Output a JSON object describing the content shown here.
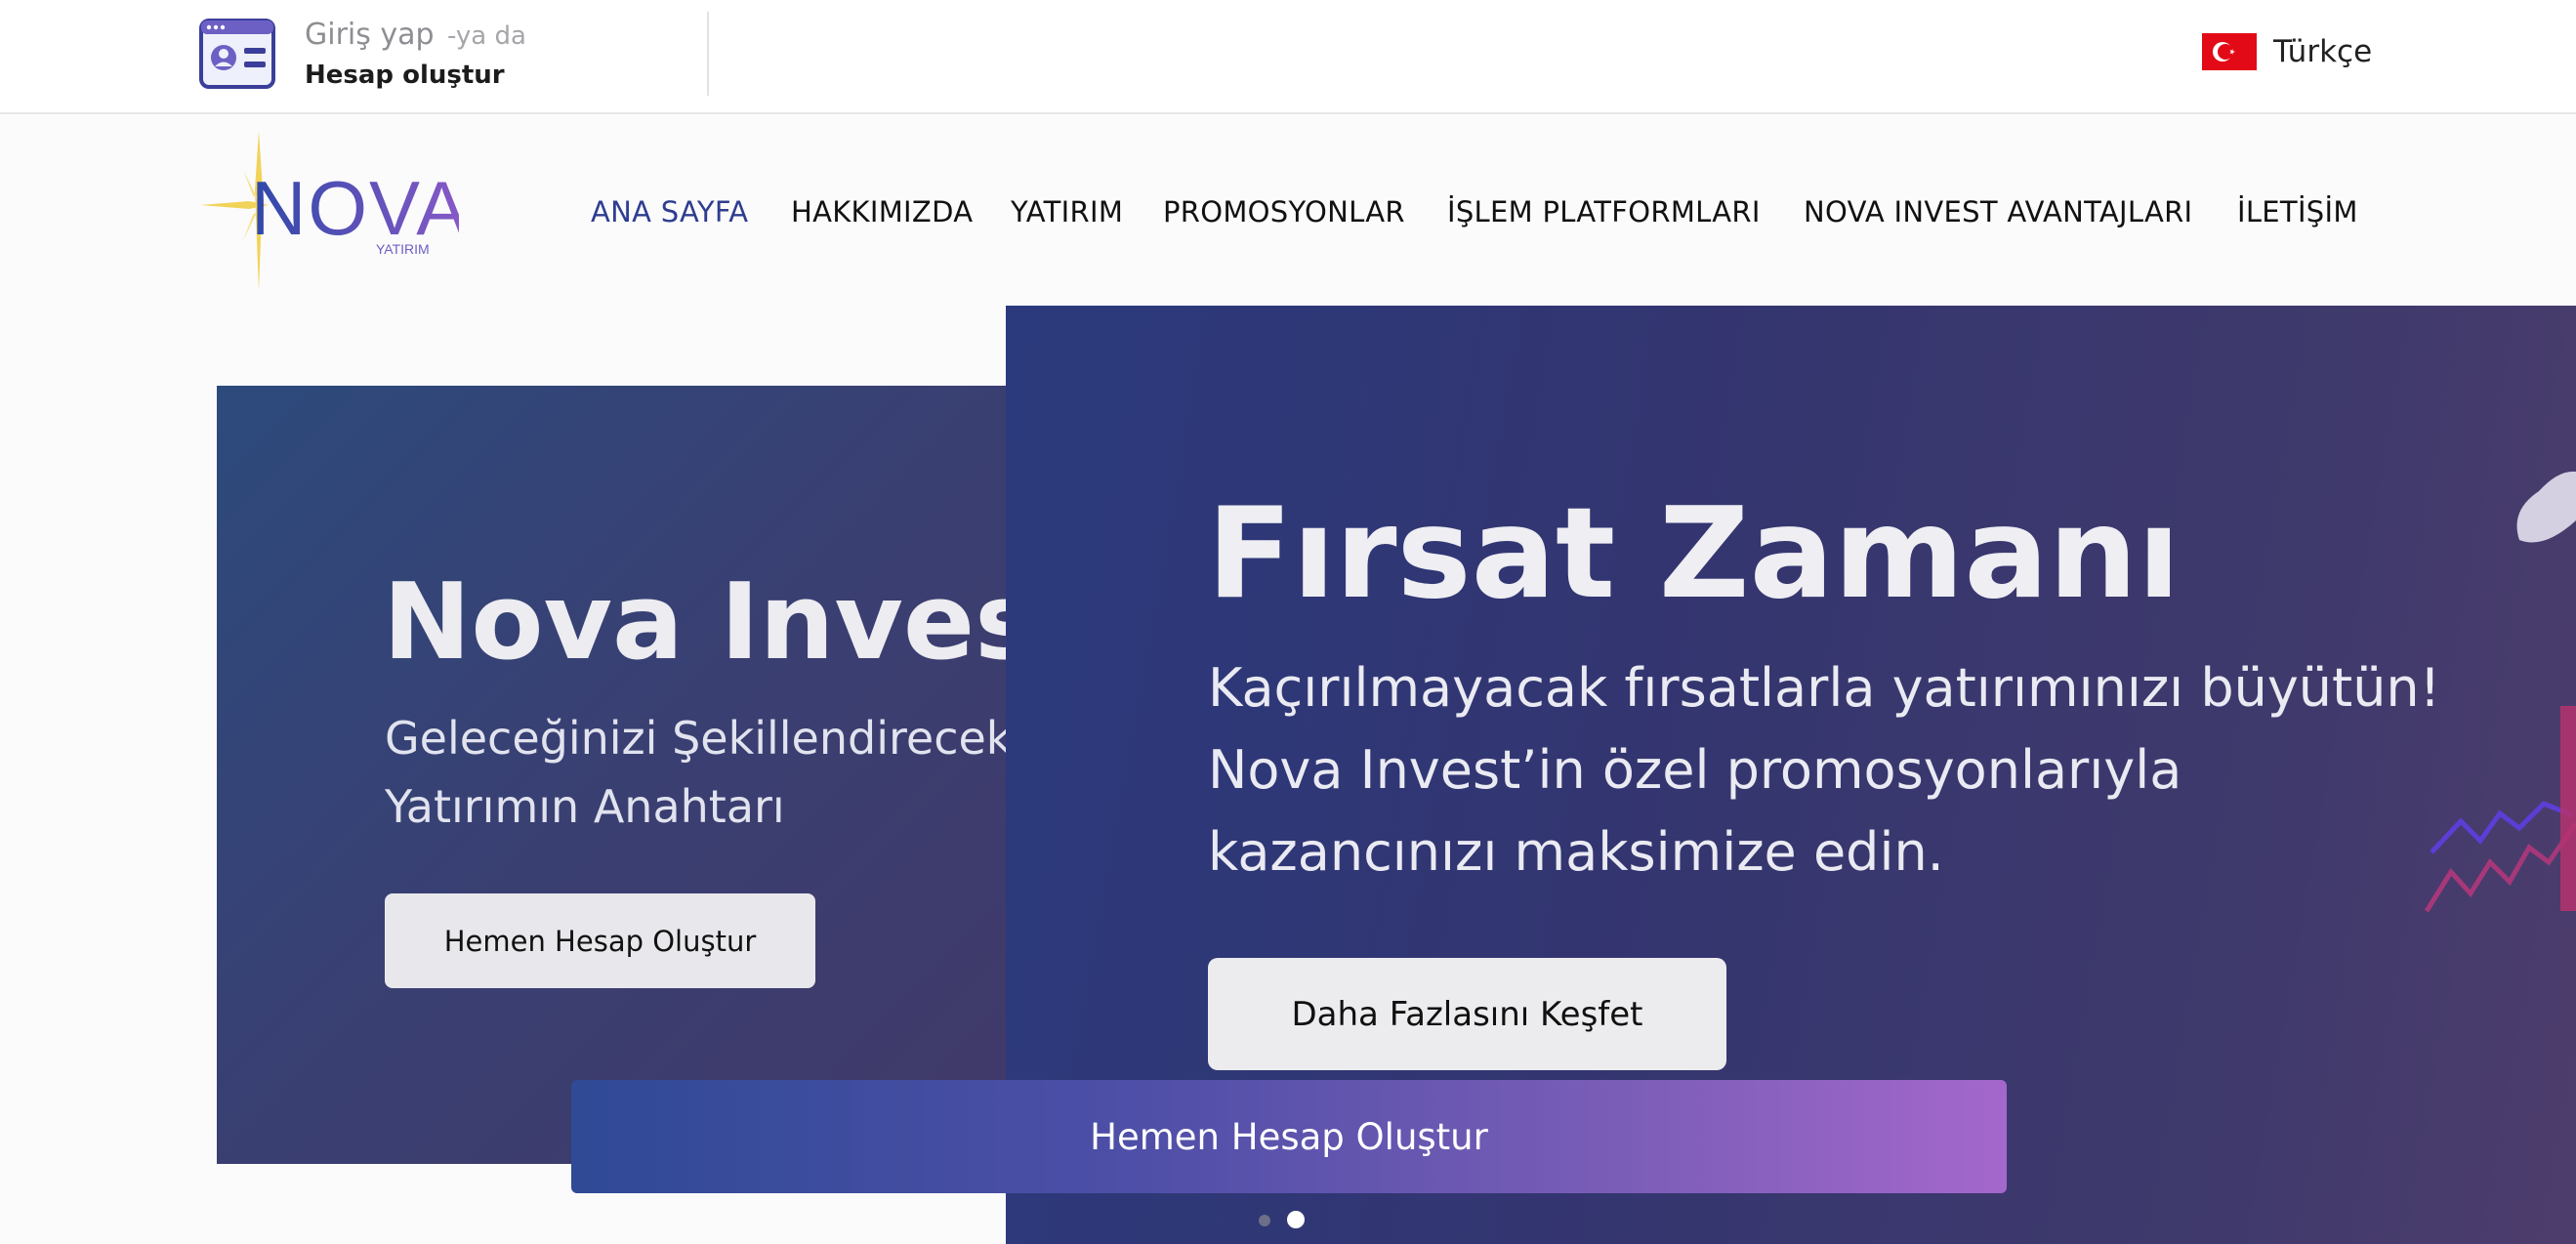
{
  "topbar": {
    "login_label": "Giriş yap",
    "or_label": "-ya da",
    "register_label": "Hesap oluştur",
    "language": "Türkçe"
  },
  "logo": {
    "brand": "NOVA",
    "tagline": "YATIRIM"
  },
  "nav": {
    "items": [
      {
        "label": "ANA SAYFA",
        "active": true
      },
      {
        "label": "HAKKIMIZDA",
        "active": false
      },
      {
        "label": "YATIRIM",
        "active": false
      },
      {
        "label": "PROMOSYONLAR",
        "active": false
      },
      {
        "label": "İŞLEM PLATFORMLARI",
        "active": false
      },
      {
        "label": "NOVA INVEST AVANTAJLARI",
        "active": false
      },
      {
        "label": "İLETİŞİM",
        "active": false
      }
    ]
  },
  "slides": [
    {
      "title": "Nova Invest",
      "subtitle": "Geleceğinizi Şekillendirecek Ç",
      "subtitle_line2": "Yatırımın Anahtarı",
      "button": "Hemen Hesap Oluştur"
    },
    {
      "title": "Fırsat Zamanı",
      "subtitle": "Kaçırılmayacak fırsatlarla yatırımınızı büyütün! Nova Invest’in özel promosyonlarıyla kazancınızı maksimize edin.",
      "button": "Daha Fazlasını Keşfet"
    }
  ],
  "cta": {
    "label": "Hemen Hesap Oluştur"
  },
  "carousel": {
    "active_index": 2,
    "count": 2
  },
  "colors": {
    "accent": "#2e3d8f",
    "cta_start": "#2f4a96",
    "cta_end": "#a467cc",
    "flag": "#e30a17"
  }
}
